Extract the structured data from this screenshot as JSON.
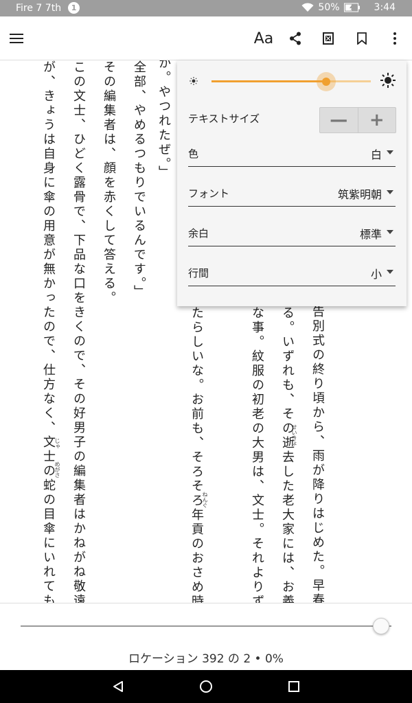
{
  "status": {
    "device": "Fire 7 7th",
    "notifications": "1",
    "battery": "50%",
    "time": "3:44"
  },
  "toolbar": {
    "font_button": "Aa",
    "icons": [
      "menu-icon",
      "font-icon",
      "share-icon",
      "xray-icon",
      "bookmark-icon",
      "more-icon"
    ]
  },
  "book": {
    "columns": [
      "か。やつれたぜ。」",
      "全部、やめるつもりでいるんです。」",
      "その編集者は、顔を赤くして答える。",
      "この文士、ひどく露骨で、下品な口をきくので、その好男子の編集者はかねがね敬遠してい",
      "が、きょうは自身に傘の用意が無かったので、仕方なく、文士の蛇の目傘にいれてもらい、か",
      "たらしいな。お前も、そろそろ年貢のおさめ時じゃ",
      "な事。紋服の初老の大男は、文士。それよりずっと",
      "る。いずれも、その逝去した老大家には、お義理一",
      "告別式の終り頃から、雨が降りはじめた。早春の雨"
    ],
    "ruby": {
      "seikyo": "せいきょ",
      "nengu": "ねんぐ",
      "ja": "じゃ",
      "megasa": "めがさ"
    }
  },
  "settings": {
    "brightness": 0.72,
    "text_size_label": "テキストサイズ",
    "decrease": "—",
    "increase": "+",
    "color_label": "色",
    "color_value": "白",
    "font_label": "フォント",
    "font_value": "筑紫明朝",
    "margin_label": "余白",
    "margin_value": "標準",
    "spacing_label": "行間",
    "spacing_value": "小"
  },
  "location": {
    "text": "ロケーション 392 の 2 • 0%",
    "progress": 0.0
  },
  "colors": {
    "accent": "#f0a030",
    "statusbar": "#9e9e9e",
    "navbar": "#000000"
  }
}
